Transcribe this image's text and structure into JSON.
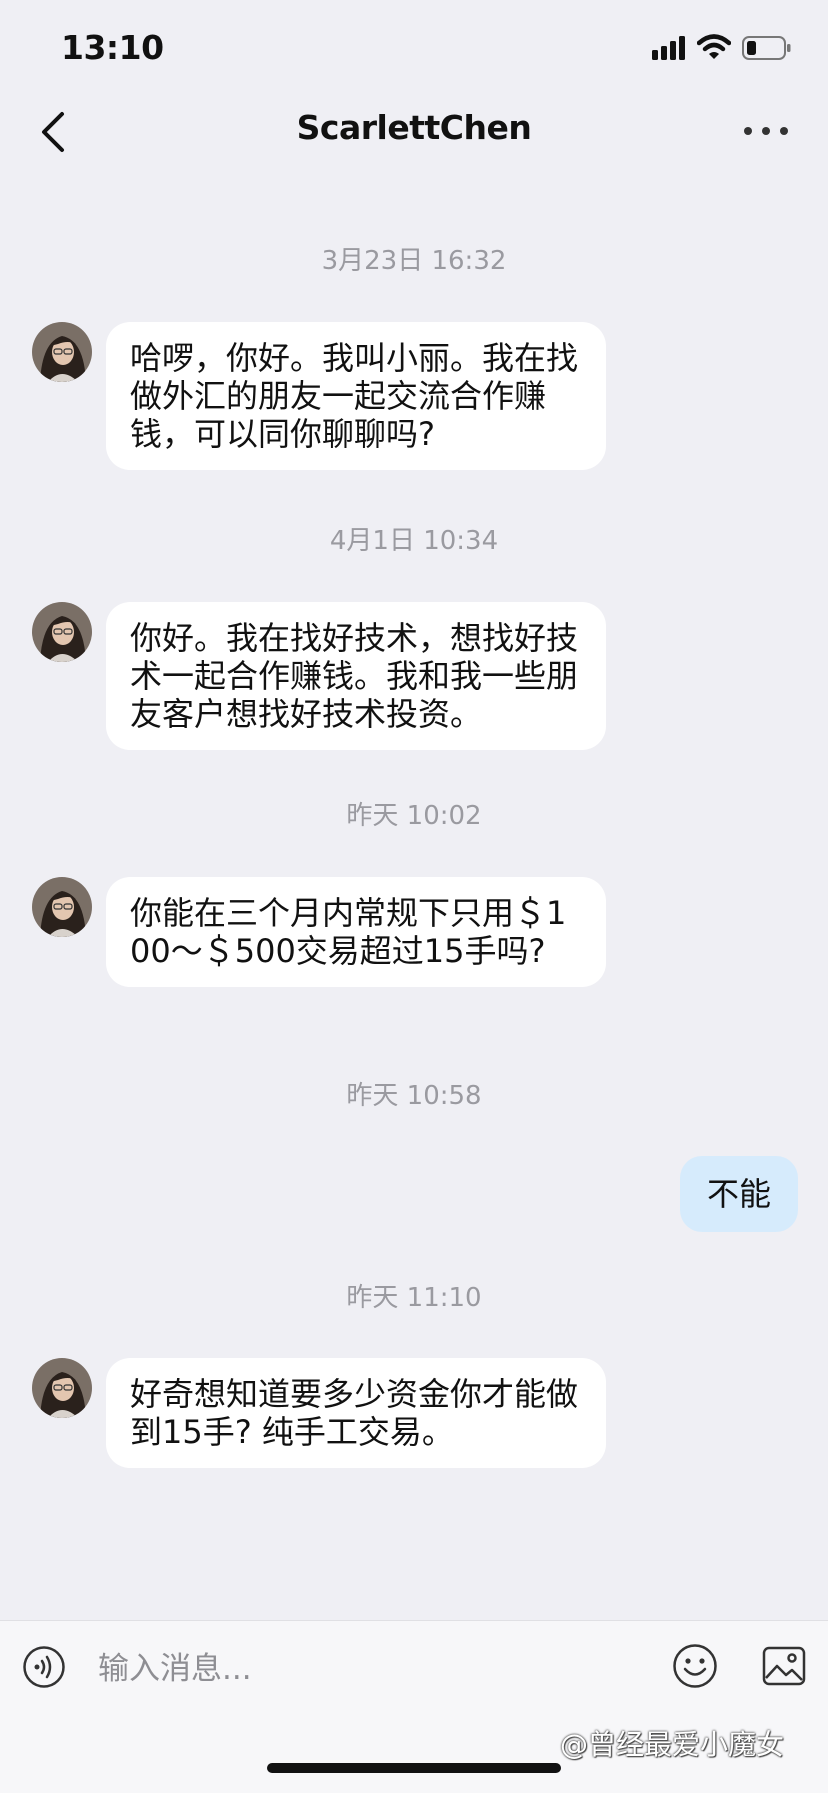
{
  "status_bar": {
    "time": "13:10",
    "icons": [
      "cellular-signal-icon",
      "wifi-icon",
      "battery-icon"
    ]
  },
  "header": {
    "title": "ScarlettChen",
    "back_icon": "chevron-left-icon",
    "more_icon": "ellipsis-icon"
  },
  "conversation": {
    "groups": [
      {
        "timestamp": "3月23日 16:32",
        "sender": "contact",
        "text": "哈啰，你好。我叫小丽。我在找做外汇的朋友一起交流合作赚钱，可以同你聊聊吗?"
      },
      {
        "timestamp": "4月1日 10:34",
        "sender": "contact",
        "text": "你好。我在找好技术，想找好技术一起合作赚钱。我和我一些朋友客户想找好技术投资。"
      },
      {
        "timestamp": "昨天 10:02",
        "sender": "contact",
        "text": "你能在三个月内常规下只用＄100～＄500交易超过15手吗?"
      },
      {
        "timestamp": "昨天 10:58",
        "sender": "me",
        "text": "不能"
      },
      {
        "timestamp": "昨天 11:10",
        "sender": "contact",
        "text": "好奇想知道要多少资金你才能做到15手? 纯手工交易。"
      }
    ]
  },
  "input_bar": {
    "placeholder": "输入消息...",
    "value": "",
    "voice_icon": "voice-wave-icon",
    "emoji_icon": "smiley-icon",
    "image_icon": "image-icon"
  },
  "watermark": "@曾经最爱小魔女",
  "colors": {
    "background": "#efeff4",
    "incoming_bubble": "#ffffff",
    "outgoing_bubble": "#d6ebfc",
    "timestamp_text": "#9a9aa0"
  }
}
